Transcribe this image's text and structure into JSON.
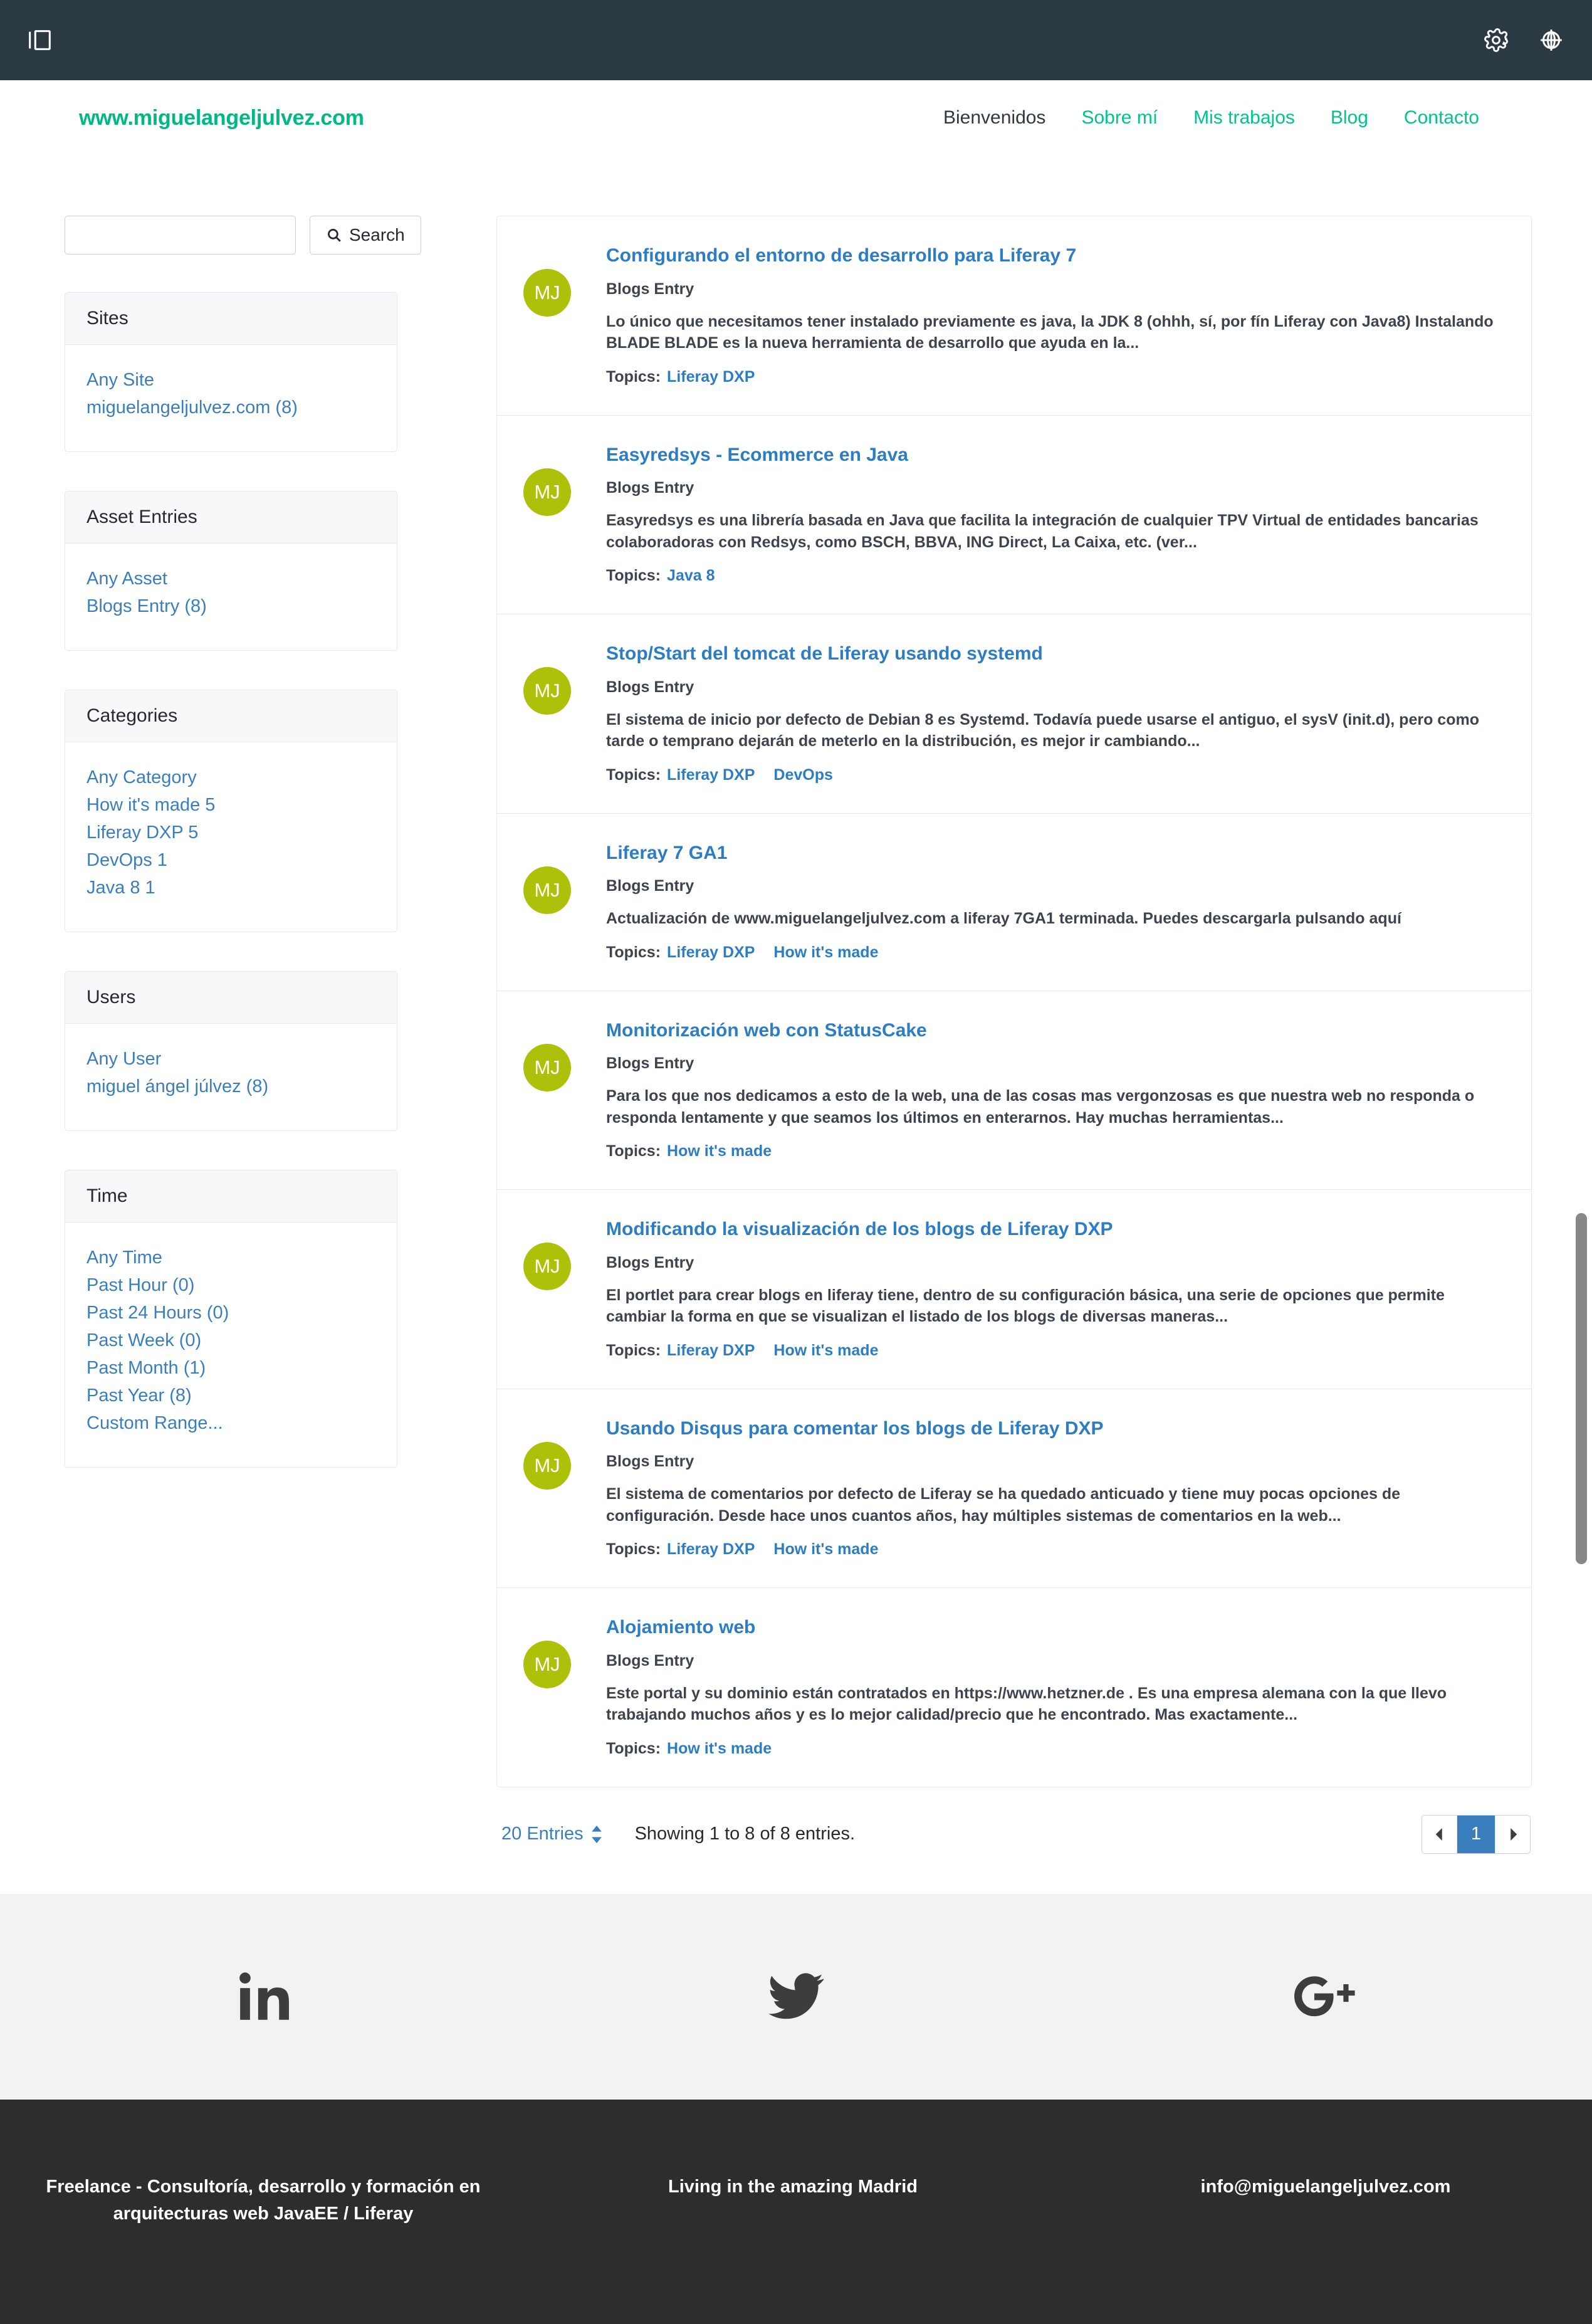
{
  "admin_bar": {
    "panel_toggle_icon": "panel-toggle-icon",
    "gear_icon": "gear-icon",
    "globe_icon": "globe-icon"
  },
  "header": {
    "brand": "www.miguelangeljulvez.com",
    "nav": [
      {
        "label": "Bienvenidos",
        "active": true
      },
      {
        "label": "Sobre mí",
        "active": false
      },
      {
        "label": "Mis trabajos",
        "active": false
      },
      {
        "label": "Blog",
        "active": false
      },
      {
        "label": "Contacto",
        "active": false
      }
    ]
  },
  "search": {
    "value": "",
    "placeholder": "",
    "button_label": "Search",
    "button_icon": "search-icon"
  },
  "facets": [
    {
      "title": "Sites",
      "items": [
        "Any Site",
        "miguelangeljulvez.com (8)"
      ]
    },
    {
      "title": "Asset Entries",
      "items": [
        "Any Asset",
        "Blogs Entry (8)"
      ]
    },
    {
      "title": "Categories",
      "items": [
        "Any Category",
        "How it's made 5",
        "Liferay DXP 5",
        "DevOps 1",
        "Java 8 1"
      ]
    },
    {
      "title": "Users",
      "items": [
        "Any User",
        "miguel ángel júlvez (8)"
      ]
    },
    {
      "title": "Time",
      "items": [
        "Any Time",
        "Past Hour (0)",
        "Past 24 Hours (0)",
        "Past Week (0)",
        "Past Month (1)",
        "Past Year (8)",
        "Custom Range..."
      ]
    }
  ],
  "results": [
    {
      "avatar": "MJ",
      "title": "Configurando el entorno de desarrollo para Liferay 7",
      "type": "Blogs Entry",
      "description": "Lo único que necesitamos tener instalado previamente es java, la JDK 8 (ohhh, sí, por fín Liferay con Java8)  Instalando BLADE BLADE es la nueva herramienta de desarrollo que ayuda en la...",
      "topics_label": "Topics:",
      "topics": [
        "Liferay DXP"
      ]
    },
    {
      "avatar": "MJ",
      "title": "Easyredsys - Ecommerce en Java",
      "type": "Blogs Entry",
      "description": "Easyredsys es una librería basada en Java que facilita la integración de cualquier TPV Virtual de entidades bancarias colaboradoras con Redsys, como BSCH, BBVA, ING Direct, La Caixa, etc. (ver...",
      "topics_label": "Topics:",
      "topics": [
        "Java 8"
      ]
    },
    {
      "avatar": "MJ",
      "title": "Stop/Start del tomcat de Liferay usando systemd",
      "type": "Blogs Entry",
      "description": "El sistema de inicio por defecto de Debian 8 es Systemd. Todavía puede usarse el antiguo, el sysV (init.d), pero como tarde o temprano dejarán de meterlo en la distribución, es mejor ir cambiando...",
      "topics_label": "Topics:",
      "topics": [
        "Liferay DXP",
        "DevOps"
      ]
    },
    {
      "avatar": "MJ",
      "title": "Liferay 7 GA1",
      "type": "Blogs Entry",
      "description": "Actualización de www.miguelangeljulvez.com a liferay 7GA1 terminada.  Puedes descargarla pulsando aquí",
      "topics_label": "Topics:",
      "topics": [
        "Liferay DXP",
        "How it's made"
      ]
    },
    {
      "avatar": "MJ",
      "title": "Monitorización web con StatusCake",
      "type": "Blogs Entry",
      "description": "Para los que nos dedicamos a esto de la web, una de las cosas mas vergonzosas es que nuestra web no responda o responda lentamente y que seamos los últimos en enterarnos. Hay muchas herramientas...",
      "topics_label": "Topics:",
      "topics": [
        "How it's made"
      ]
    },
    {
      "avatar": "MJ",
      "title": "Modificando la visualización de los blogs de Liferay DXP",
      "type": "Blogs Entry",
      "description": "El portlet para crear blogs en liferay tiene, dentro de su configuración básica, una serie de opciones que permite cambiar la forma en que se visualizan el listado de los blogs de diversas maneras...",
      "topics_label": "Topics:",
      "topics": [
        "Liferay DXP",
        "How it's made"
      ]
    },
    {
      "avatar": "MJ",
      "title": "Usando Disqus para comentar los blogs de Liferay DXP",
      "type": "Blogs Entry",
      "description": "El sistema de comentarios por defecto de Liferay se ha quedado anticuado y tiene muy pocas opciones de configuración. Desde hace unos cuantos años, hay múltiples sistemas de comentarios en la web...",
      "topics_label": "Topics:",
      "topics": [
        "Liferay DXP",
        "How it's made"
      ]
    },
    {
      "avatar": "MJ",
      "title": "Alojamiento web",
      "type": "Blogs Entry",
      "description": "Este portal y su dominio están contratados en https://www.hetzner.de . Es una empresa alemana con la que llevo trabajando muchos años y es lo mejor calidad/precio que he encontrado. Mas exactamente...",
      "topics_label": "Topics:",
      "topics": [
        "How it's made"
      ]
    }
  ],
  "pagination": {
    "entries_label": "20 Entries",
    "showing": "Showing 1 to 8 of 8 entries.",
    "prev_icon": "chevron-left-icon",
    "next_icon": "chevron-right-icon",
    "current_page": "1"
  },
  "social": [
    {
      "name": "linkedin-icon"
    },
    {
      "name": "twitter-icon"
    },
    {
      "name": "google-plus-icon"
    }
  ],
  "footer": {
    "col1": "Freelance - Consultoría, desarrollo y formación en arquitecturas web JavaEE / Liferay",
    "col2": "Living in the amazing Madrid",
    "col3": "info@miguelangeljulvez.com"
  },
  "colors": {
    "admin_bar": "#2b3943",
    "brand": "#00b884",
    "nav_link": "#00c48f",
    "link": "#3b7ebd",
    "title_link": "#2d7dc4",
    "avatar": "#aec10a",
    "footer_bg": "#2d2d2d",
    "social_bg": "#f2f2f2"
  }
}
